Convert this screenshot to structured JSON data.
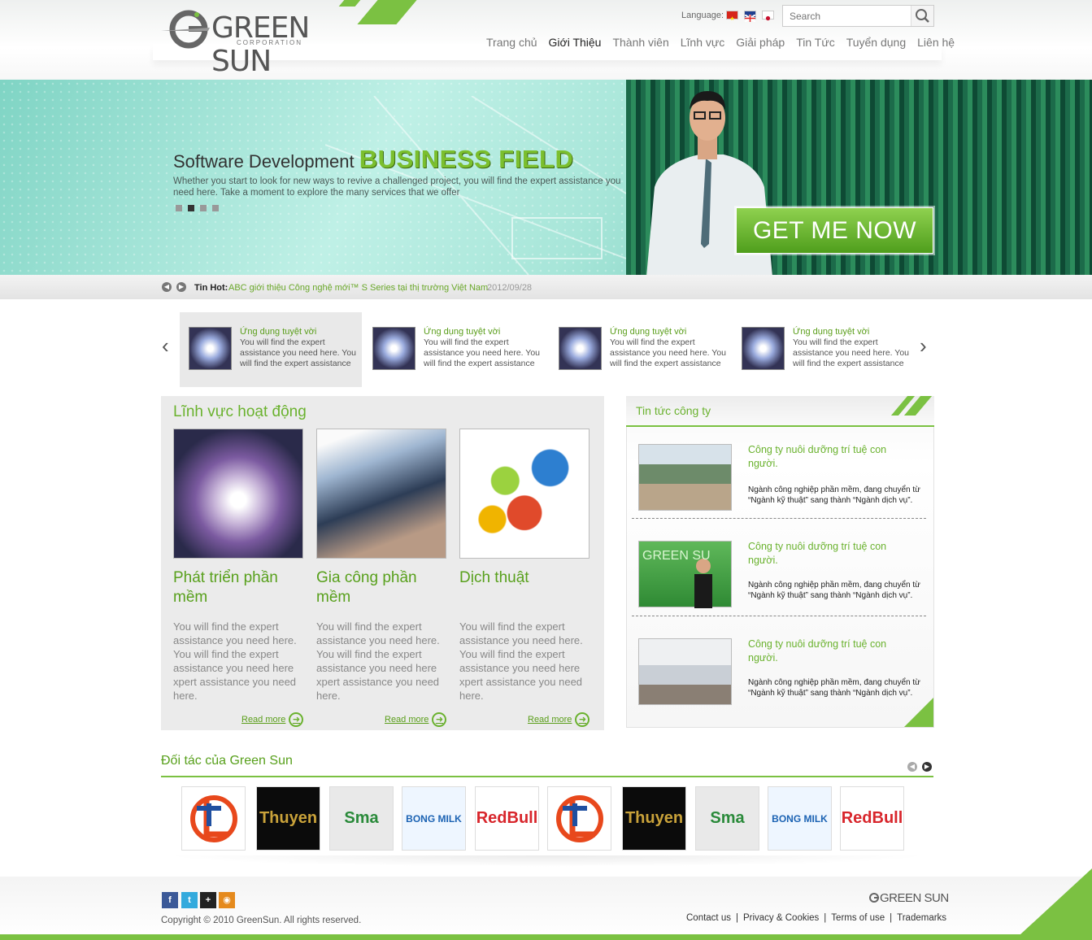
{
  "header": {
    "logo_text": "GREEN SUN",
    "logo_sub": "CORPORATION",
    "language_label": "Language:",
    "search_placeholder": "Search",
    "nav": [
      "Trang chủ",
      "Giới Thiệu",
      "Thành viên",
      "Lĩnh vực",
      "Giải pháp",
      "Tin Tức",
      "Tuyển dụng",
      "Liên hệ"
    ],
    "nav_active_index": 1
  },
  "hero": {
    "title_prefix": "Software Development",
    "title_emphasis": "BUSINESS FIELD",
    "description": "Whether you start to look for new ways to revive a challenged project, you will find the expert assistance you need here. Take a moment to explore the many services that we offer",
    "cta": "GET ME NOW",
    "active_slide": 2,
    "slide_count": 4
  },
  "ticker": {
    "label": "Tin Hot:",
    "text": "ABC giới thiệu Công nghệ mới™ S Series tại thị trường Việt Nam",
    "date": "2012/09/28"
  },
  "apps": [
    {
      "title": "Ứng dụng tuyệt vời",
      "desc": "You will find the expert assistance you need here. You will find the expert assistance"
    },
    {
      "title": "Ứng dụng tuyệt vời",
      "desc": "You will find the expert assistance you need here. You will find the expert assistance"
    },
    {
      "title": "Ứng dụng tuyệt vời",
      "desc": "You will find the expert assistance you need here. You will find the expert assistance"
    },
    {
      "title": "Ứng dụng tuyệt vời",
      "desc": "You will find the expert assistance you need here. You will find the expert assistance"
    }
  ],
  "fields": {
    "title": "Lĩnh vực hoạt động",
    "items": [
      {
        "name": "Phát triển phần mềm",
        "desc": "You will find the expert assistance you need here. You will find the expert assistance you need here xpert assistance you need here.",
        "more": "Read more"
      },
      {
        "name": "Gia công phần mềm",
        "desc": "You will find the expert assistance you need here. You will find the expert assistance you need here xpert assistance you need here.",
        "more": "Read more"
      },
      {
        "name": "Dịch thuật",
        "desc": "You will find the expert assistance you need here. You will find the expert assistance you need here xpert assistance you need here.",
        "more": "Read more"
      }
    ]
  },
  "news": {
    "title": "Tin tức công ty",
    "items": [
      {
        "headline": "Công ty nuôi dưỡng trí tuệ con người.",
        "summary": "Ngành công nghiệp phần mềm, đang chuyển từ “Ngành kỹ thuật” sang thành “Ngành dịch vụ”."
      },
      {
        "headline": "Công ty nuôi dưỡng trí tuệ con người.",
        "summary": "Ngành công nghiệp phần mềm, đang chuyển từ “Ngành kỹ thuật” sang thành “Ngành dịch vụ”."
      },
      {
        "headline": "Công ty nuôi dưỡng trí tuệ con người.",
        "summary": "Ngành công nghiệp phần mềm, đang chuyển từ “Ngành kỹ thuật” sang thành “Ngành dịch vụ”."
      }
    ]
  },
  "partners": {
    "title": "Đối tác của Green Sun",
    "logos": [
      {
        "name": "Thang Long logo",
        "text": "",
        "bg": "#ffffff",
        "fg": "#e8481c"
      },
      {
        "name": "Thuyen logo",
        "text": "Thuyen",
        "bg": "#0b0b0b",
        "fg": "#c9a23a"
      },
      {
        "name": "Sma logo",
        "text": "Sma",
        "bg": "#e9e9e9",
        "fg": "#2a8a3a"
      },
      {
        "name": "Bong Milk logo",
        "text": "BONG MILK",
        "bg": "#eef6ff",
        "fg": "#1c63b3"
      },
      {
        "name": "Red Bull logo",
        "text": "RedBull",
        "bg": "#ffffff",
        "fg": "#d8262c"
      },
      {
        "name": "Thang Long logo",
        "text": "",
        "bg": "#ffffff",
        "fg": "#e8481c"
      },
      {
        "name": "Thuyen logo",
        "text": "Thuyen",
        "bg": "#0b0b0b",
        "fg": "#c9a23a"
      },
      {
        "name": "Sma logo",
        "text": "Sma",
        "bg": "#e9e9e9",
        "fg": "#2a8a3a"
      },
      {
        "name": "Bong Milk logo",
        "text": "BONG MILK",
        "bg": "#eef6ff",
        "fg": "#1c63b3"
      },
      {
        "name": "Red Bull logo",
        "text": "RedBull",
        "bg": "#ffffff",
        "fg": "#d8262c"
      }
    ]
  },
  "footer": {
    "social": [
      "facebook-icon",
      "twitter-icon",
      "google-plus-icon",
      "rss-icon"
    ],
    "copyright": "Copyright © 2010 GreenSun. All rights reserved.",
    "links": [
      "Contact us",
      "Privacy & Cookies",
      "Terms of use",
      "Trademarks"
    ],
    "logo_text": "GREEN SUN"
  },
  "colors": {
    "accent": "#7bc142",
    "accent_dark": "#58a01c"
  }
}
